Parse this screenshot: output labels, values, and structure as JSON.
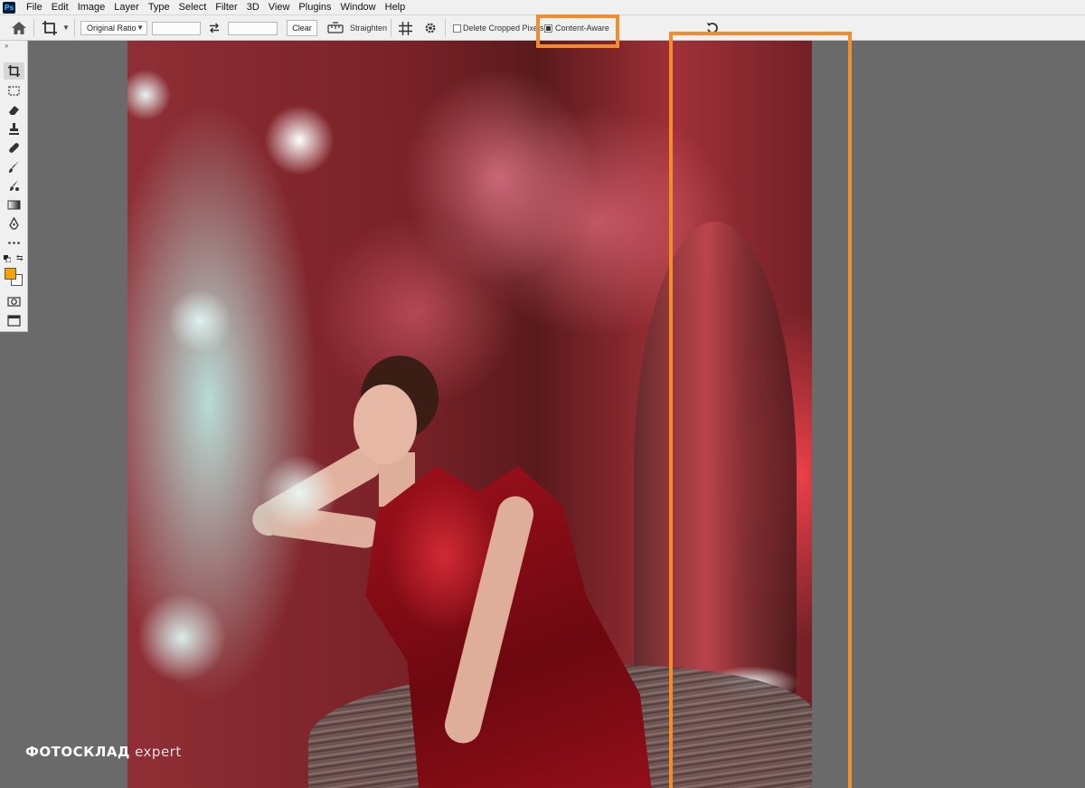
{
  "app": {
    "logo_text": "Ps",
    "menu": [
      "File",
      "Edit",
      "Image",
      "Layer",
      "Type",
      "Select",
      "Filter",
      "3D",
      "View",
      "Plugins",
      "Window",
      "Help"
    ]
  },
  "options_bar": {
    "ratio_select": "Original Ratio",
    "width_value": "",
    "height_value": "",
    "clear_label": "Clear",
    "straighten_label": "Straighten",
    "delete_cropped_label": "Delete Cropped Pixels",
    "delete_cropped_checked": false,
    "content_aware_label": "Content-Aware",
    "content_aware_checked": true
  },
  "tools": {
    "foreground_color": "#f8a400",
    "background_color": "#ffffff",
    "items": [
      "crop-tool",
      "marquee-tool",
      "eraser-tool",
      "clone-stamp-tool",
      "healing-brush-tool",
      "brush-tool",
      "mixer-brush-tool",
      "gradient-tool",
      "pen-tool",
      "more-tools"
    ]
  },
  "watermark": {
    "brand": "ФОТОСКЛАД",
    "suffix": "expert"
  },
  "highlight_color": "#f28c2c"
}
